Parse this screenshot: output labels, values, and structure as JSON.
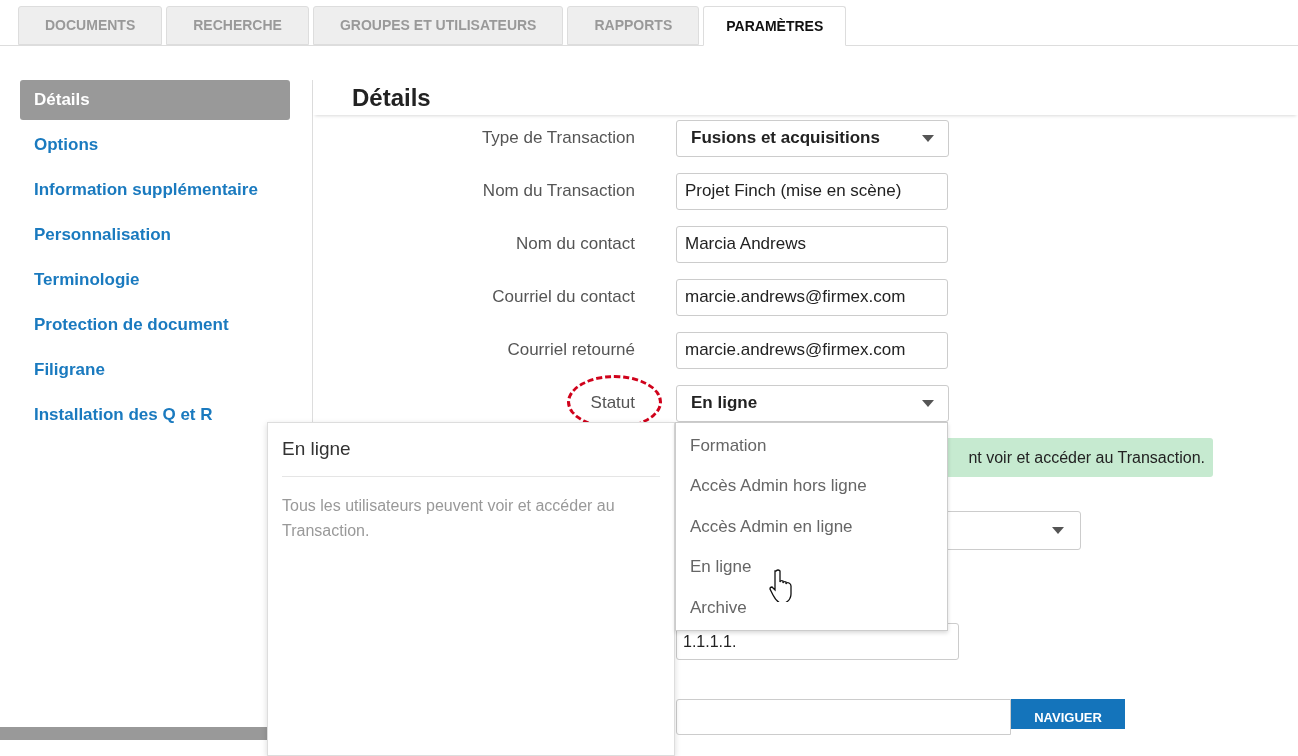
{
  "tabs": [
    {
      "label": "DOCUMENTS",
      "selected": false
    },
    {
      "label": "RECHERCHE",
      "selected": false
    },
    {
      "label": "GROUPES ET UTILISATEURS",
      "selected": false
    },
    {
      "label": "RAPPORTS",
      "selected": false
    },
    {
      "label": "PARAMÈTRES",
      "selected": true
    }
  ],
  "sidebar": {
    "items": [
      {
        "label": "Détails",
        "selected": true
      },
      {
        "label": "Options",
        "selected": false
      },
      {
        "label": "Information supplémentaire",
        "selected": false
      },
      {
        "label": "Personnalisation",
        "selected": false
      },
      {
        "label": "Terminologie",
        "selected": false
      },
      {
        "label": "Protection de document",
        "selected": false
      },
      {
        "label": "Filigrane",
        "selected": false
      },
      {
        "label": "Installation des Q et R",
        "selected": false
      }
    ]
  },
  "heading": "Détails",
  "form": [
    {
      "label": "Type de Transaction",
      "kind": "select",
      "value": "Fusions et acquisitions"
    },
    {
      "label": "Nom du Transaction",
      "kind": "text",
      "value": "Projet Finch (mise en scène)"
    },
    {
      "label": "Nom du contact",
      "kind": "text",
      "value": "Marcia Andrews"
    },
    {
      "label": "Courriel du contact",
      "kind": "text",
      "value": "marcie.andrews@firmex.com"
    },
    {
      "label": "Courriel retourné",
      "kind": "text",
      "value": "marcie.andrews@firmex.com"
    },
    {
      "label": "Statut",
      "kind": "select",
      "value": "En ligne",
      "circled": true
    }
  ],
  "status_message": "nt voir et accéder au Transaction.",
  "lower_fields": [
    {
      "kind": "select"
    },
    {
      "kind": "text",
      "value": "1.1.1.1."
    },
    {
      "kind": "browse",
      "button": "NAVIGUER"
    }
  ],
  "status_dropdown": {
    "options": [
      "Formation",
      "Accès Admin hors ligne",
      "Accès Admin en ligne",
      "En ligne",
      "Archive"
    ]
  },
  "status_info": {
    "title": "En ligne",
    "description": "Tous les utilisateurs peuvent voir et accéder au Transaction."
  }
}
